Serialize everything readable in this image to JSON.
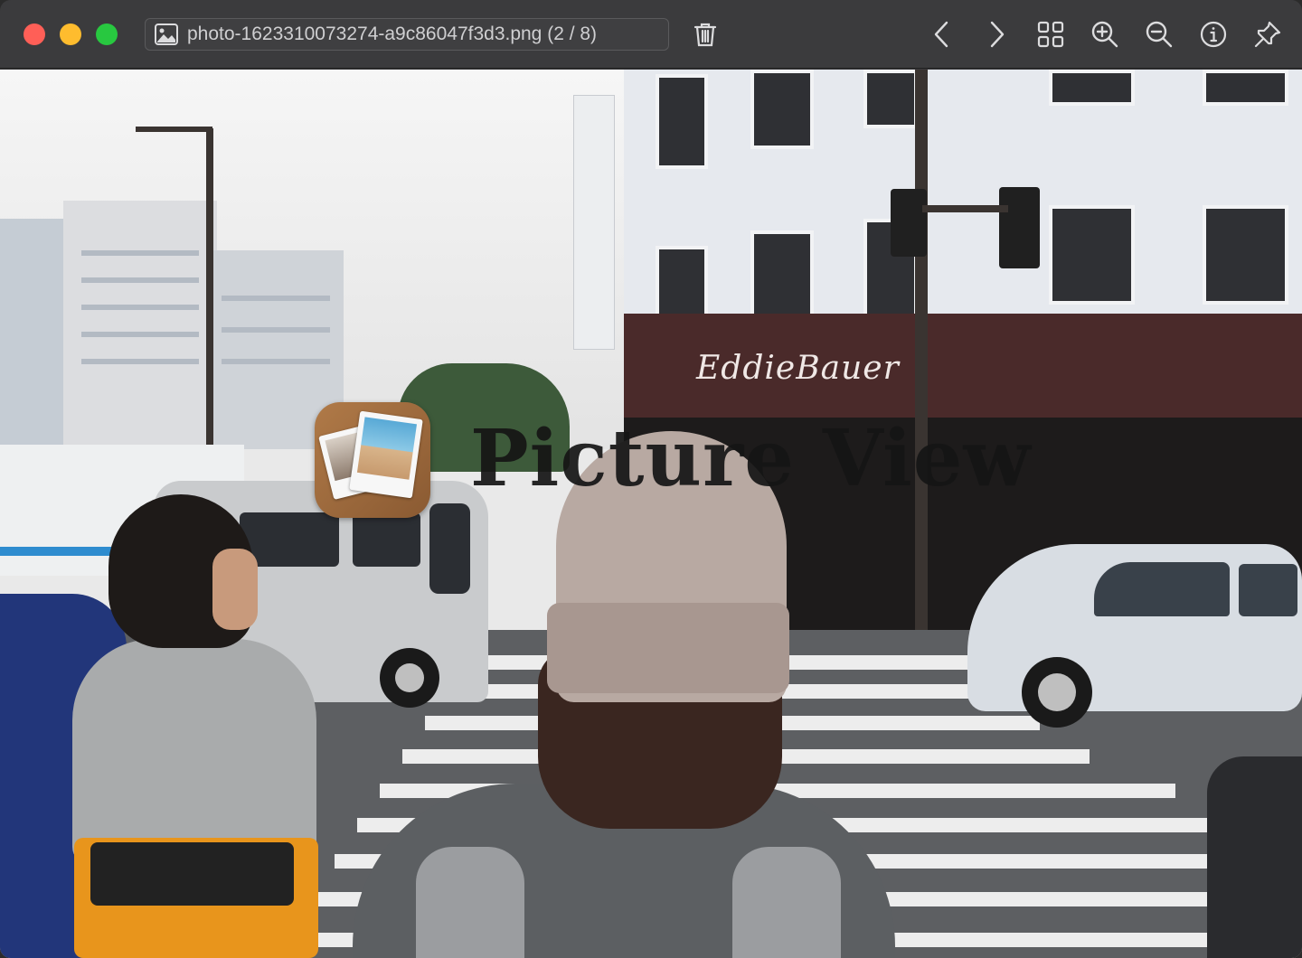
{
  "window": {
    "filename": "photo-1623310073274-a9c86047f3d3.png (2 / 8)"
  },
  "toolbar": {
    "icons": [
      "image-file-icon",
      "trash-icon",
      "chevron-left-icon",
      "chevron-right-icon",
      "grid-icon",
      "zoom-in-icon",
      "zoom-out-icon",
      "info-icon",
      "pin-icon"
    ]
  },
  "overlay": {
    "app_name": "Picture View"
  },
  "photo": {
    "store_sign": "EddieBauer"
  },
  "colors": {
    "titlebar": "#3b3b3d",
    "close": "#ff5f57",
    "minimize": "#febc2e",
    "maximize": "#28c840",
    "icon": "#dcdcde"
  }
}
